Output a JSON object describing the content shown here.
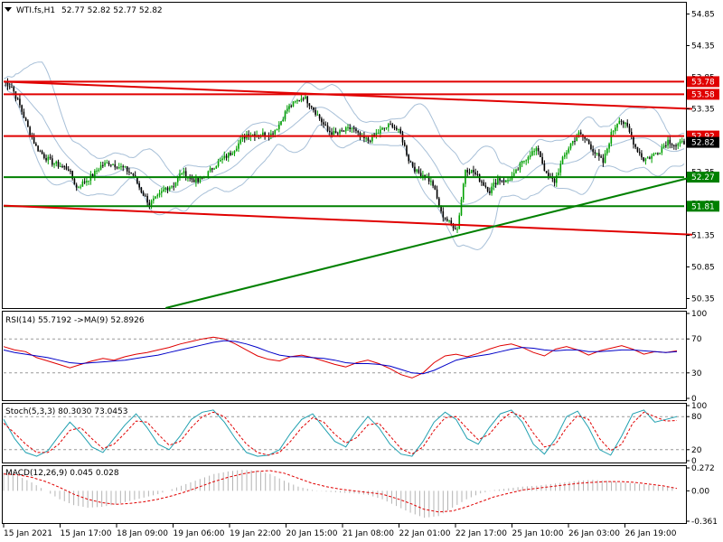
{
  "main_header": {
    "symbol": "WTI.fs,H1",
    "ohlc": "52.77 52.82 52.77 52.82"
  },
  "rsi_header": "RSI(14) 55.7192  ->MA(9) 52.8926",
  "stoch_header": "Stoch(5,3,3) 80.3030 73.0453",
  "macd_header": "MACD(12,26,9) 0.045 0.028",
  "colors": {
    "bull": "#00a000",
    "bear": "#000000",
    "resistance": "#e00000",
    "support": "#008000",
    "rsi": "#e00000",
    "rsi_ma": "#0000c8",
    "stoch_main": "#20a0b0",
    "stoch_signal": "#e00000",
    "macd_hist": "#b4b4b4",
    "macd_signal": "#e00000",
    "bands": "#a8c0d8"
  },
  "chart_data": [
    {
      "type": "candlestick",
      "title": "WTI.fs,H1",
      "ylim": [
        50.2,
        55.0
      ],
      "yticks": [
        "54.85",
        "54.35",
        "53.85",
        "53.35",
        "52.85",
        "52.35",
        "51.85",
        "51.35",
        "50.85",
        "50.35"
      ],
      "xticks": [
        "15 Jan 2021",
        "15 Jan 17:00",
        "18 Jan 09:00",
        "19 Jan 06:00",
        "19 Jan 22:00",
        "20 Jan 15:00",
        "21 Jan 08:00",
        "22 Jan 01:00",
        "22 Jan 17:00",
        "25 Jan 10:00",
        "26 Jan 03:00",
        "26 Jan 19:00"
      ],
      "anchors": [
        [
          0,
          53.78
        ],
        [
          4,
          53.7
        ],
        [
          8,
          53.4
        ],
        [
          12,
          53.05
        ],
        [
          16,
          52.75
        ],
        [
          20,
          52.6
        ],
        [
          24,
          52.5
        ],
        [
          28,
          52.45
        ],
        [
          32,
          52.4
        ],
        [
          36,
          52.1
        ],
        [
          40,
          52.2
        ],
        [
          44,
          52.3
        ],
        [
          48,
          52.45
        ],
        [
          52,
          52.5
        ],
        [
          56,
          52.45
        ],
        [
          60,
          52.4
        ],
        [
          64,
          52.3
        ],
        [
          68,
          52.05
        ],
        [
          72,
          51.85
        ],
        [
          76,
          51.95
        ],
        [
          80,
          52.1
        ],
        [
          84,
          52.15
        ],
        [
          88,
          52.35
        ],
        [
          92,
          52.25
        ],
        [
          96,
          52.2
        ],
        [
          100,
          52.3
        ],
        [
          104,
          52.45
        ],
        [
          108,
          52.55
        ],
        [
          112,
          52.65
        ],
        [
          116,
          52.8
        ],
        [
          120,
          52.95
        ],
        [
          124,
          52.95
        ],
        [
          128,
          52.95
        ],
        [
          132,
          52.95
        ],
        [
          136,
          53.1
        ],
        [
          140,
          53.35
        ],
        [
          144,
          53.45
        ],
        [
          148,
          53.55
        ],
        [
          152,
          53.4
        ],
        [
          156,
          53.2
        ],
        [
          160,
          53.0
        ],
        [
          164,
          52.95
        ],
        [
          168,
          53.0
        ],
        [
          172,
          53.05
        ],
        [
          176,
          52.9
        ],
        [
          180,
          52.85
        ],
        [
          184,
          52.95
        ],
        [
          188,
          53.05
        ],
        [
          192,
          53.1
        ],
        [
          196,
          52.95
        ],
        [
          200,
          52.55
        ],
        [
          204,
          52.35
        ],
        [
          208,
          52.3
        ],
        [
          212,
          52.15
        ],
        [
          216,
          51.7
        ],
        [
          220,
          51.55
        ],
        [
          224,
          51.45
        ],
        [
          228,
          52.4
        ],
        [
          232,
          52.35
        ],
        [
          236,
          52.2
        ],
        [
          240,
          52.05
        ],
        [
          244,
          52.25
        ],
        [
          248,
          52.2
        ],
        [
          252,
          52.3
        ],
        [
          256,
          52.5
        ],
        [
          260,
          52.65
        ],
        [
          264,
          52.7
        ],
        [
          268,
          52.3
        ],
        [
          272,
          52.2
        ],
        [
          276,
          52.55
        ],
        [
          280,
          52.8
        ],
        [
          284,
          52.95
        ],
        [
          288,
          52.85
        ],
        [
          292,
          52.65
        ],
        [
          296,
          52.5
        ],
        [
          300,
          52.95
        ],
        [
          304,
          53.2
        ],
        [
          308,
          53.05
        ],
        [
          312,
          52.75
        ],
        [
          316,
          52.55
        ],
        [
          320,
          52.6
        ],
        [
          324,
          52.7
        ],
        [
          328,
          52.85
        ],
        [
          332,
          52.77
        ],
        [
          336,
          52.82
        ]
      ],
      "levels": [
        {
          "label": "53.78",
          "value": 53.78,
          "color": "#e00000"
        },
        {
          "label": "53.58",
          "value": 53.58,
          "color": "#e00000"
        },
        {
          "label": "52.92",
          "value": 52.92,
          "color": "#e00000"
        },
        {
          "label": "52.82",
          "value": 52.82,
          "color": "#000000"
        },
        {
          "label": "52.27",
          "value": 52.27,
          "color": "#008000"
        },
        {
          "label": "51.81",
          "value": 51.81,
          "color": "#008000"
        }
      ],
      "trendlines": [
        {
          "from": [
            0,
            53.78
          ],
          "to": [
            340,
            53.35
          ],
          "color": "#e00000"
        },
        {
          "from": [
            0,
            51.82
          ],
          "to": [
            340,
            51.36
          ],
          "color": "#e00000"
        },
        {
          "from": [
            80,
            50.2
          ],
          "to": [
            340,
            52.27
          ],
          "color": "#008000"
        }
      ]
    },
    {
      "type": "line",
      "title": "RSI(14)",
      "ylim": [
        0,
        100
      ],
      "yticks": [
        "100",
        "70",
        "30",
        "0"
      ],
      "series": [
        {
          "name": "RSI(14)",
          "values": [
            61,
            57,
            55,
            48,
            44,
            40,
            36,
            40,
            44,
            47,
            45,
            49,
            52,
            54,
            57,
            60,
            64,
            67,
            70,
            72,
            70,
            64,
            57,
            50,
            46,
            44,
            49,
            51,
            48,
            44,
            40,
            37,
            42,
            45,
            41,
            35,
            28,
            24,
            30,
            42,
            50,
            52,
            49,
            53,
            58,
            62,
            64,
            60,
            54,
            50,
            58,
            61,
            57,
            51,
            56,
            59,
            62,
            58,
            52,
            55,
            54,
            56
          ]
        },
        {
          "name": "MA(9)",
          "values": [
            57,
            54,
            52,
            50,
            48,
            45,
            42,
            41,
            42,
            43,
            44,
            45,
            47,
            49,
            51,
            54,
            57,
            60,
            63,
            66,
            68,
            67,
            64,
            60,
            55,
            51,
            49,
            49,
            48,
            47,
            45,
            42,
            41,
            41,
            40,
            38,
            34,
            30,
            29,
            33,
            39,
            45,
            48,
            50,
            52,
            55,
            58,
            60,
            59,
            57,
            56,
            57,
            57,
            55,
            55,
            56,
            57,
            57,
            56,
            55,
            54,
            55
          ]
        }
      ]
    },
    {
      "type": "line",
      "title": "Stoch(5,3,3)",
      "ylim": [
        0,
        100
      ],
      "yticks": [
        "100",
        "80",
        "20",
        "0"
      ],
      "series": [
        {
          "name": "Main",
          "values": [
            75,
            40,
            15,
            8,
            18,
            45,
            70,
            50,
            25,
            15,
            40,
            65,
            85,
            60,
            30,
            20,
            45,
            75,
            88,
            92,
            70,
            40,
            15,
            8,
            10,
            20,
            50,
            75,
            85,
            60,
            35,
            25,
            55,
            80,
            60,
            30,
            12,
            8,
            35,
            70,
            88,
            75,
            40,
            30,
            60,
            85,
            92,
            70,
            30,
            12,
            40,
            80,
            90,
            60,
            20,
            10,
            45,
            85,
            92,
            70,
            75,
            80
          ]
        },
        {
          "name": "Signal",
          "values": [
            68,
            50,
            30,
            15,
            15,
            30,
            55,
            60,
            40,
            22,
            30,
            50,
            72,
            70,
            48,
            28,
            35,
            60,
            80,
            88,
            80,
            55,
            30,
            15,
            10,
            15,
            35,
            60,
            78,
            70,
            48,
            32,
            42,
            65,
            68,
            45,
            22,
            12,
            25,
            55,
            78,
            80,
            58,
            38,
            48,
            72,
            88,
            80,
            50,
            25,
            30,
            60,
            82,
            75,
            40,
            18,
            30,
            68,
            88,
            80,
            72,
            73
          ]
        }
      ]
    },
    {
      "type": "bar",
      "title": "MACD(12,26,9)",
      "ylim": [
        -0.361,
        0.272
      ],
      "yticks": [
        "0.272",
        "0.00",
        "-0.361"
      ],
      "series": [
        {
          "name": "MACD",
          "values": [
            0.22,
            0.18,
            0.1,
            0.0,
            -0.1,
            -0.17,
            -0.2,
            -0.19,
            -0.16,
            -0.12,
            -0.08,
            -0.04,
            0.02,
            0.08,
            0.14,
            0.2,
            0.23,
            0.25,
            0.24,
            0.2,
            0.12,
            0.05,
            0.01,
            -0.01,
            -0.02,
            -0.03,
            -0.05,
            -0.1,
            -0.18,
            -0.26,
            -0.32,
            -0.3,
            -0.2,
            -0.1,
            -0.03,
            0.01,
            0.03,
            0.05,
            0.06,
            0.08,
            0.1,
            0.12,
            0.13,
            0.12,
            0.1,
            0.09,
            0.07,
            0.05,
            0.045
          ]
        },
        {
          "name": "Signal",
          "values": [
            0.2,
            0.19,
            0.16,
            0.11,
            0.04,
            -0.04,
            -0.1,
            -0.14,
            -0.16,
            -0.15,
            -0.13,
            -0.1,
            -0.06,
            -0.01,
            0.05,
            0.11,
            0.16,
            0.2,
            0.23,
            0.24,
            0.21,
            0.15,
            0.09,
            0.05,
            0.02,
            0.0,
            -0.02,
            -0.04,
            -0.09,
            -0.15,
            -0.22,
            -0.25,
            -0.24,
            -0.19,
            -0.13,
            -0.07,
            -0.03,
            0.01,
            0.03,
            0.05,
            0.07,
            0.09,
            0.1,
            0.11,
            0.11,
            0.1,
            0.08,
            0.06,
            0.028
          ]
        }
      ]
    }
  ]
}
